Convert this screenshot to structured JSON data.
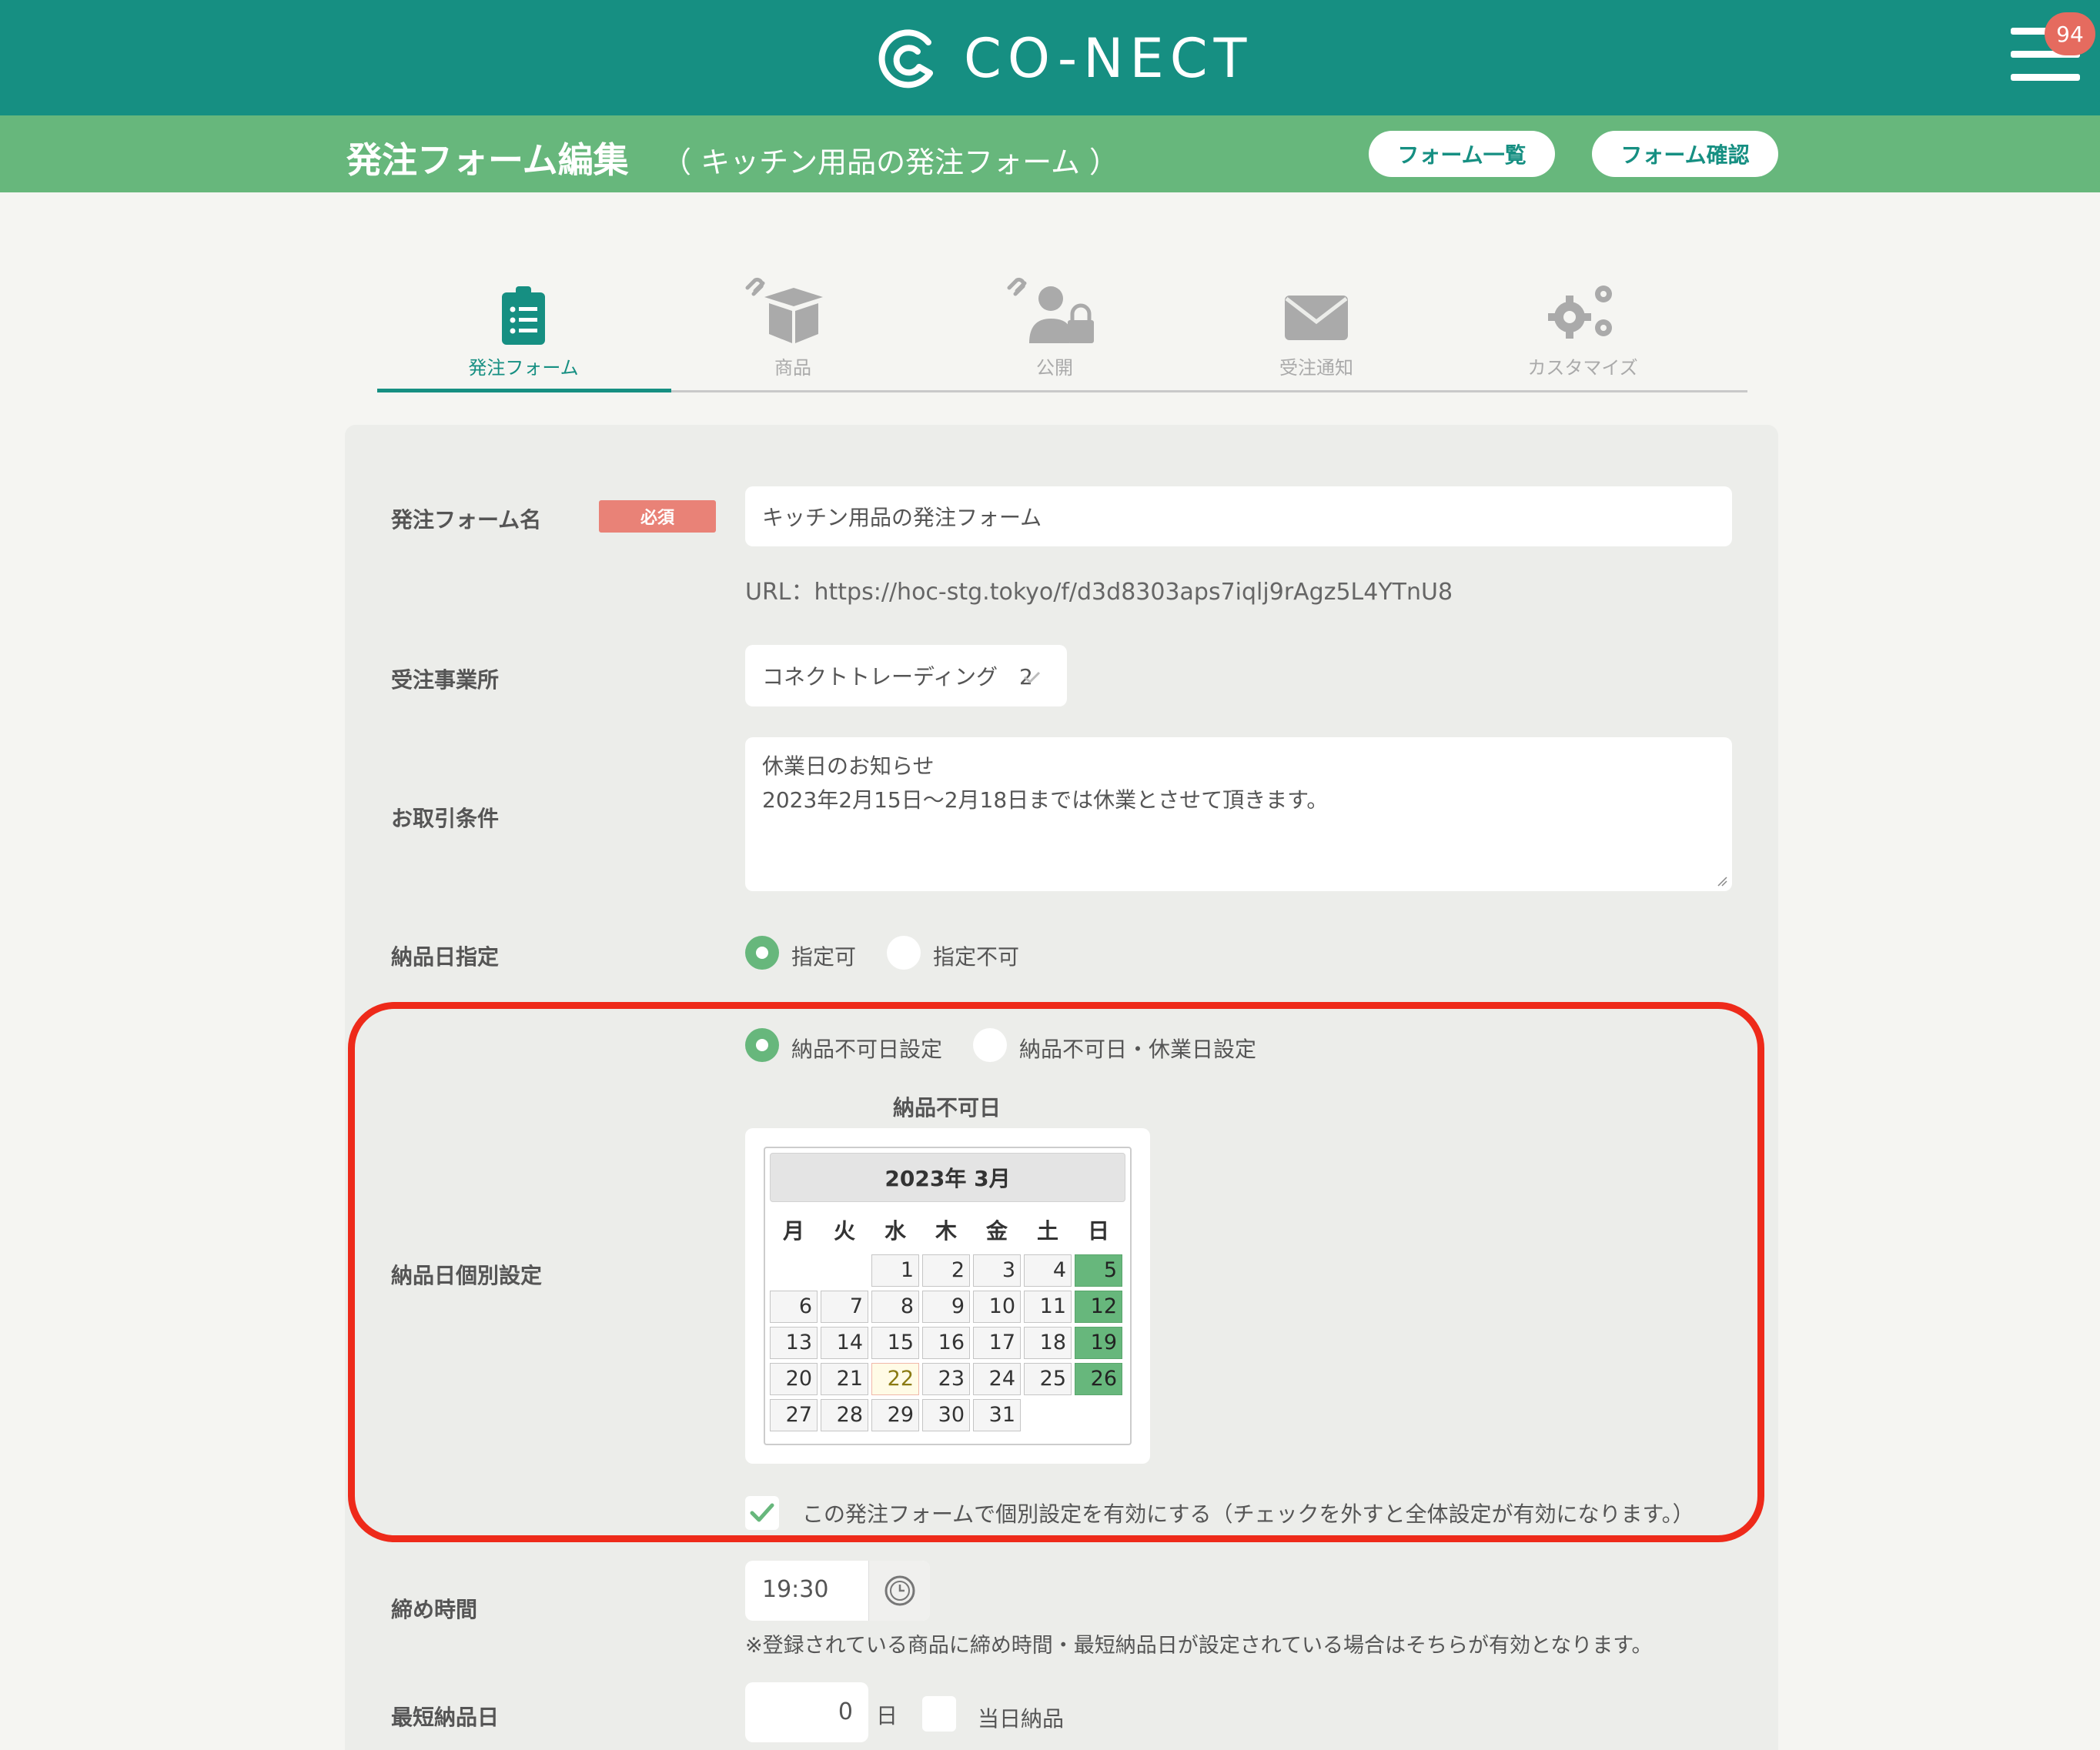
{
  "app": {
    "brand": "CO-NECT",
    "notification_count": "94"
  },
  "header": {
    "title": "発注フォーム編集",
    "subtitle": "（ キッチン用品の発注フォーム ）",
    "buttons": {
      "list": "フォーム一覧",
      "confirm": "フォーム確認"
    }
  },
  "tabs": [
    {
      "label": "発注フォーム",
      "icon": "clipboard-list-icon",
      "active": true
    },
    {
      "label": "商品",
      "icon": "linked-box-icon",
      "active": false
    },
    {
      "label": "公開",
      "icon": "linked-user-lock-icon",
      "active": false
    },
    {
      "label": "受注通知",
      "icon": "envelope-icon",
      "active": false
    },
    {
      "label": "カスタマイズ",
      "icon": "gears-icon",
      "active": false
    }
  ],
  "form": {
    "name": {
      "label": "発注フォーム名",
      "required": "必須",
      "value": "キッチン用品の発注フォーム",
      "url": "URL：https://hoc-stg.tokyo/f/d3d8303aps7iqlj9rAgz5L4YTnU8"
    },
    "office": {
      "label": "受注事業所",
      "value": "コネクトトレーディング　2"
    },
    "terms": {
      "label": "お取引条件",
      "line1": "休業日のお知らせ",
      "line2": "2023年2月15日〜2月18日までは休業とさせて頂きます。"
    },
    "delivery_date": {
      "label": "納品日指定",
      "option_yes": "指定可",
      "option_no": "指定不可",
      "selected": "指定可"
    },
    "individual": {
      "label": "納品日個別設定",
      "option_a": "納品不可日設定",
      "option_b": "納品不可日・休業日設定",
      "selected": "納品不可日設定",
      "calendar_title": "納品不可日",
      "checkbox_label": "この発注フォームで個別設定を有効にする（チェックを外すと全体設定が有効になります。）",
      "checkbox_checked": true
    },
    "deadline": {
      "label": "締め時間",
      "value": "19:30",
      "note": "※登録されている商品に締め時間・最短納品日が設定されている場合はそちらが有効となります。"
    },
    "shortest": {
      "label": "最短納品日",
      "value": "0",
      "unit": "日",
      "same_day": "当日納品",
      "same_day_checked": false
    }
  },
  "calendar": {
    "month": "2023年 3月",
    "weekdays": [
      "月",
      "火",
      "水",
      "木",
      "金",
      "土",
      "日"
    ],
    "first_weekday_index": 2,
    "days_in_month": 31,
    "selected_days": [
      5,
      12,
      19,
      26
    ],
    "today": 22
  },
  "colors": {
    "topbar": "#168f82",
    "subbar": "#67b77c",
    "accent": "#67b77c",
    "required": "#e98277",
    "highlight": "#ee2a1a",
    "badge": "#e56b5f"
  }
}
